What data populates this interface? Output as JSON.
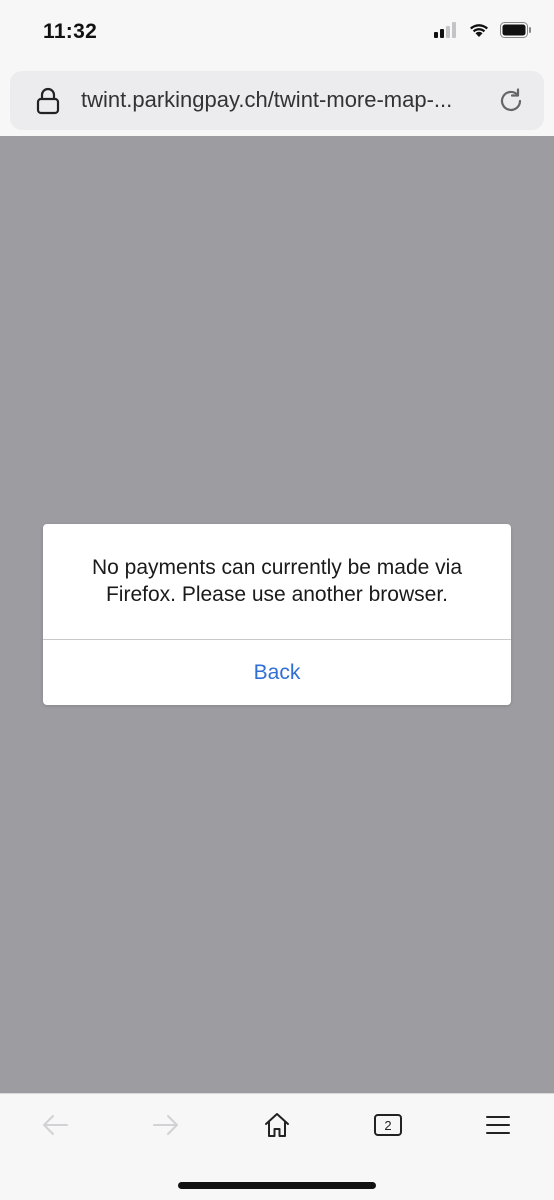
{
  "status_bar": {
    "time": "11:32",
    "icons": [
      "cellular-signal-icon",
      "wifi-icon",
      "battery-icon"
    ]
  },
  "address_bar": {
    "lock_icon": "lock-icon",
    "url": "twint.parkingpay.ch/twint-more-map-...",
    "reload_icon": "reload-icon"
  },
  "dialog": {
    "message": "No payments can currently be made via Firefox. Please use another browser.",
    "back_label": "Back"
  },
  "toolbar": {
    "items": [
      {
        "icon": "back-arrow-icon",
        "enabled": false
      },
      {
        "icon": "forward-arrow-icon",
        "enabled": false
      },
      {
        "icon": "home-icon",
        "enabled": true
      },
      {
        "icon": "tabs-icon",
        "count": "2",
        "enabled": true
      },
      {
        "icon": "menu-icon",
        "enabled": true
      }
    ]
  },
  "colors": {
    "page_background": "#9d9ca1",
    "link_blue": "#2f6fd6",
    "chrome_background": "#f7f7f8",
    "address_field": "#ececef"
  }
}
